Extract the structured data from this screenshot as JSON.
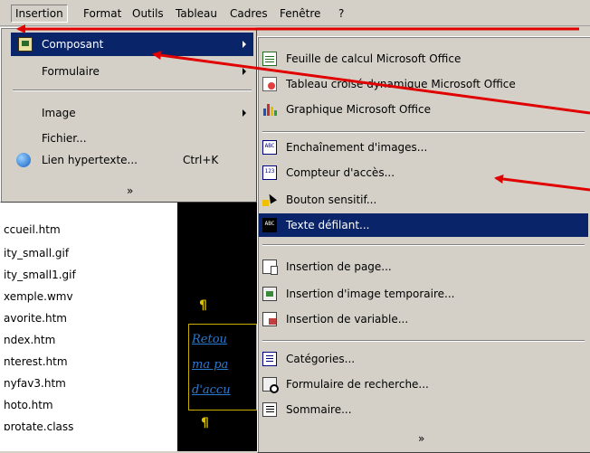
{
  "menubar": {
    "items": [
      {
        "label": "Insertion",
        "active": true
      },
      {
        "label": "Format"
      },
      {
        "label": "Outils"
      },
      {
        "label": "Tableau"
      },
      {
        "label": "Cadres"
      },
      {
        "label": "Fenêtre"
      },
      {
        "label": "?"
      }
    ]
  },
  "insert_menu": {
    "items": [
      {
        "label": "Composant",
        "icon": "component-icon",
        "submenu": true,
        "highlighted": true
      },
      {
        "label": "Formulaire",
        "submenu": true
      },
      {
        "label": "Image",
        "submenu": true
      },
      {
        "label": "Fichier..."
      },
      {
        "label": "Lien hypertexte...",
        "shortcut": "Ctrl+K",
        "icon": "globe-link-icon"
      }
    ],
    "more": "»"
  },
  "component_submenu": {
    "items": [
      {
        "label": "Feuille de calcul Microsoft Office",
        "icon": "spreadsheet-icon"
      },
      {
        "label": "Tableau croisé dynamique Microsoft Office",
        "icon": "pivot-table-icon"
      },
      {
        "label": "Graphique Microsoft Office",
        "icon": "chart-icon"
      },
      {
        "label": "Enchaînement d'images...",
        "icon": "banner-ad-icon",
        "badge": "ABC"
      },
      {
        "label": "Compteur d'accès...",
        "icon": "hit-counter-icon",
        "badge": "123"
      },
      {
        "label": "Bouton sensitif...",
        "icon": "hover-button-icon"
      },
      {
        "label": "Texte défilant...",
        "icon": "marquee-icon",
        "badge": "ABC",
        "highlighted": true
      },
      {
        "label": "Insertion de page...",
        "icon": "include-page-icon"
      },
      {
        "label": "Insertion d'image temporaire...",
        "icon": "scheduled-picture-icon"
      },
      {
        "label": "Insertion de variable...",
        "icon": "substitution-icon"
      },
      {
        "label": "Catégories...",
        "icon": "categories-icon"
      },
      {
        "label": "Formulaire de recherche...",
        "icon": "search-form-icon"
      },
      {
        "label": "Sommaire...",
        "icon": "table-of-contents-icon"
      }
    ],
    "more": "»"
  },
  "file_list": {
    "items": [
      "ccueil.htm",
      "ity_small.gif",
      "ity_small1.gif",
      "xemple.wmv",
      "avorite.htm",
      "ndex.htm",
      "nterest.htm",
      "nyfav3.htm",
      "hoto.htm",
      "protate.class"
    ]
  },
  "editor": {
    "pilcrow": "¶",
    "link_lines": [
      "Retou",
      "ma pa",
      "d'accu"
    ]
  },
  "colors": {
    "menu_bg": "#d4d0c8",
    "highlight": "#0a246a",
    "annotation": "#e00000"
  }
}
